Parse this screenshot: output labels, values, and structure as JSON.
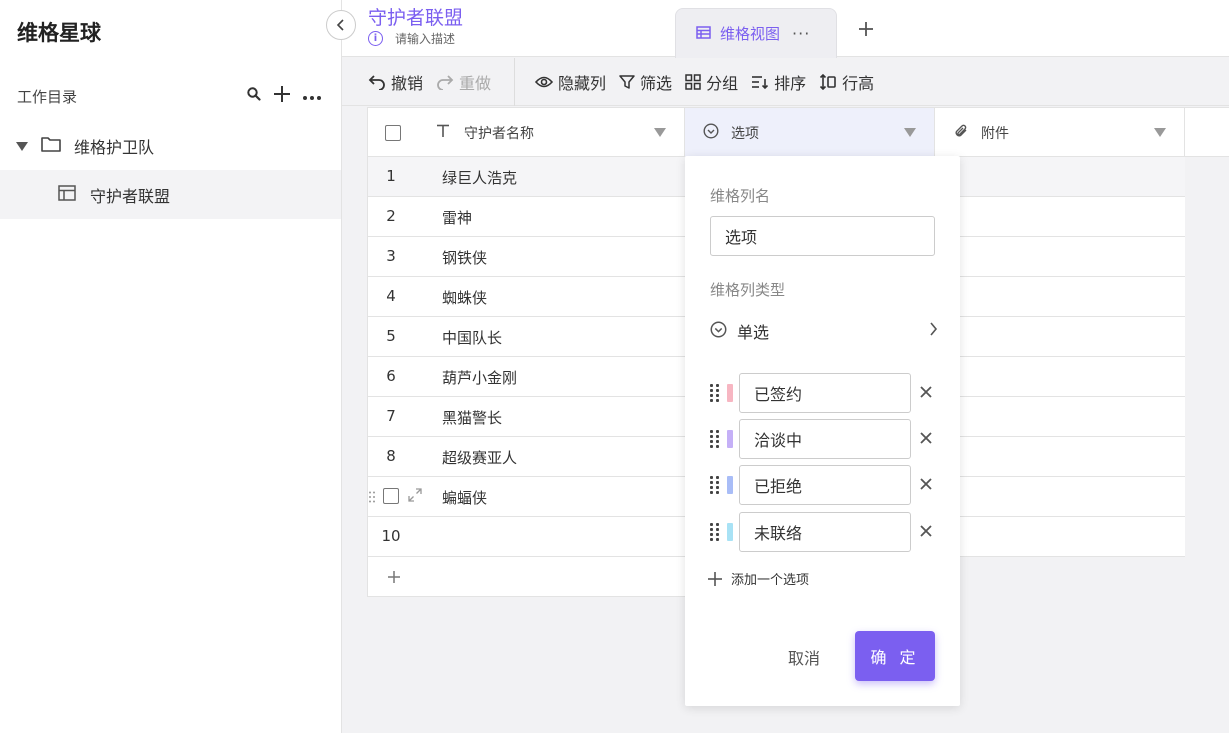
{
  "app": {
    "title": "维格星球"
  },
  "sidebar": {
    "section_label": "工作目录",
    "folder": {
      "label": "维格护卫队"
    },
    "item": {
      "label": "守护者联盟"
    }
  },
  "doc": {
    "title": "守护者联盟",
    "description": "请输入描述",
    "info_glyph": "i"
  },
  "view_tab": {
    "label": "维格视图",
    "more": "···"
  },
  "toolbar": {
    "undo": "撤销",
    "redo": "重做",
    "hide_columns": "隐藏列",
    "filter": "筛选",
    "group": "分组",
    "sort": "排序",
    "row_height": "行高"
  },
  "grid": {
    "columns": [
      "守护者名称",
      "选项",
      "附件"
    ],
    "rows": [
      {
        "num": "1",
        "name": "绿巨人浩克"
      },
      {
        "num": "2",
        "name": "雷神"
      },
      {
        "num": "3",
        "name": "钢铁侠"
      },
      {
        "num": "4",
        "name": "蜘蛛侠"
      },
      {
        "num": "5",
        "name": "中国队长"
      },
      {
        "num": "6",
        "name": "葫芦小金刚"
      },
      {
        "num": "7",
        "name": "黑猫警长"
      },
      {
        "num": "8",
        "name": "超级赛亚人"
      },
      {
        "num": "",
        "name": "蝙蝠侠"
      },
      {
        "num": "10",
        "name": ""
      }
    ]
  },
  "popup": {
    "name_label": "维格列名",
    "name_value": "选项",
    "type_label": "维格列类型",
    "type_value": "单选",
    "options": [
      {
        "label": "已签约",
        "color": "#f7b6c2"
      },
      {
        "label": "洽谈中",
        "color": "#c5b0f7"
      },
      {
        "label": "已拒绝",
        "color": "#a9bdf7"
      },
      {
        "label": "未联络",
        "color": "#a8e2f5"
      }
    ],
    "add_option": "添加一个选项",
    "cancel": "取消",
    "confirm": "确 定"
  },
  "colors": {
    "accent": "#7b5ff0"
  }
}
